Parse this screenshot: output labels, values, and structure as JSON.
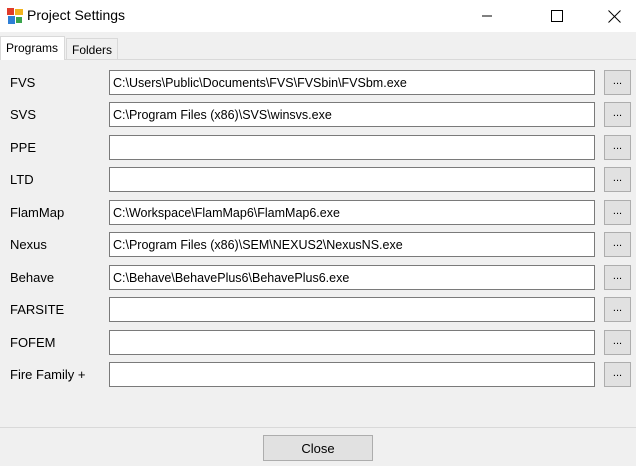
{
  "window": {
    "title": "Project Settings",
    "app_icon": "project-settings-app-icon",
    "controls": {
      "minimize_icon": "minimize-icon",
      "maximize_icon": "maximize-icon",
      "close_icon": "close-icon"
    }
  },
  "tabs": [
    {
      "label": "Programs",
      "active": true
    },
    {
      "label": "Folders",
      "active": false
    }
  ],
  "programs": [
    {
      "label": "FVS",
      "path": "C:\\Users\\Public\\Documents\\FVS\\FVSbin\\FVSbm.exe",
      "browse": "..."
    },
    {
      "label": "SVS",
      "path": "C:\\Program Files (x86)\\SVS\\winsvs.exe",
      "browse": "..."
    },
    {
      "label": "PPE",
      "path": "",
      "browse": "..."
    },
    {
      "label": "LTD",
      "path": "",
      "browse": "..."
    },
    {
      "label": "FlamMap",
      "path": "C:\\Workspace\\FlamMap6\\FlamMap6.exe",
      "browse": "..."
    },
    {
      "label": "Nexus",
      "path": "C:\\Program Files (x86)\\SEM\\NEXUS2\\NexusNS.exe",
      "browse": "..."
    },
    {
      "label": "Behave",
      "path": "C:\\Behave\\BehavePlus6\\BehavePlus6.exe",
      "browse": "..."
    },
    {
      "label": "FARSITE",
      "path": "",
      "browse": "..."
    },
    {
      "label": "FOFEM",
      "path": "",
      "browse": "..."
    },
    {
      "label": "Fire Family +",
      "path": "",
      "browse": "..."
    }
  ],
  "footer": {
    "close_label": "Close"
  }
}
